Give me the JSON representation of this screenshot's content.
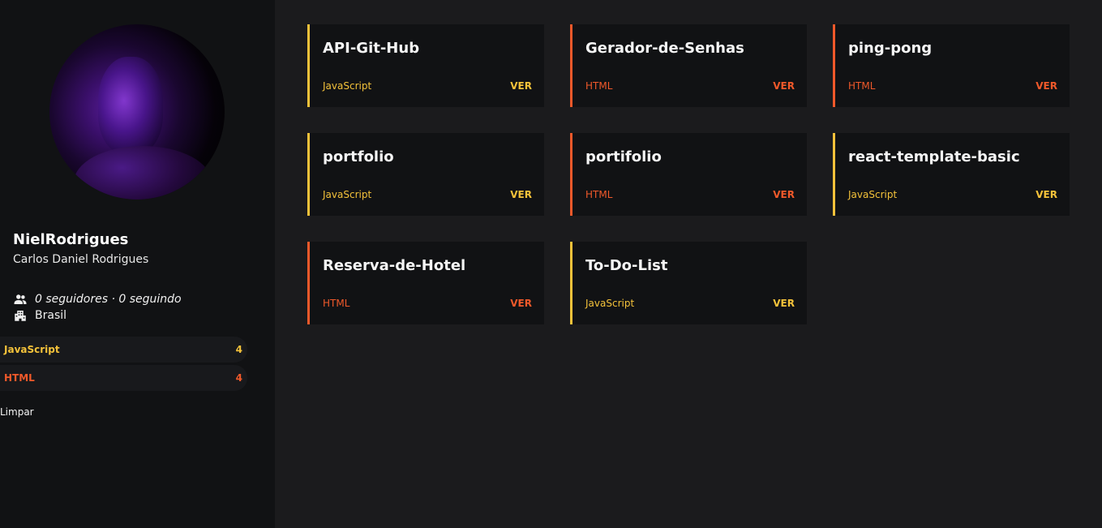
{
  "colors": {
    "javascript": "#f4c23a",
    "html": "#f0592a",
    "background": "#1b1b1d",
    "sidebar": "#111214",
    "card": "#111214"
  },
  "profile": {
    "login": "NielRodrigues",
    "name": "Carlos Daniel Rodrigues",
    "followers_text": "0 seguidores · 0 seguindo",
    "location": "Brasil",
    "followers_icon": "people-icon",
    "location_icon": "building-icon"
  },
  "language_filters": [
    {
      "label": "JavaScript",
      "count": "4",
      "lang": "javascript"
    },
    {
      "label": "HTML",
      "count": "4",
      "lang": "html"
    }
  ],
  "clear_label": "Limpar",
  "repos": [
    {
      "name": "API-Git-Hub",
      "language": "JavaScript",
      "lang": "javascript",
      "action": "VER"
    },
    {
      "name": "Gerador-de-Senhas",
      "language": "HTML",
      "lang": "html",
      "action": "VER"
    },
    {
      "name": "ping-pong",
      "language": "HTML",
      "lang": "html",
      "action": "VER"
    },
    {
      "name": "portfolio",
      "language": "JavaScript",
      "lang": "javascript",
      "action": "VER"
    },
    {
      "name": "portifolio",
      "language": "HTML",
      "lang": "html",
      "action": "VER"
    },
    {
      "name": "react-template-basic",
      "language": "JavaScript",
      "lang": "javascript",
      "action": "VER"
    },
    {
      "name": "Reserva-de-Hotel",
      "language": "HTML",
      "lang": "html",
      "action": "VER"
    },
    {
      "name": "To-Do-List",
      "language": "JavaScript",
      "lang": "javascript",
      "action": "VER"
    }
  ]
}
